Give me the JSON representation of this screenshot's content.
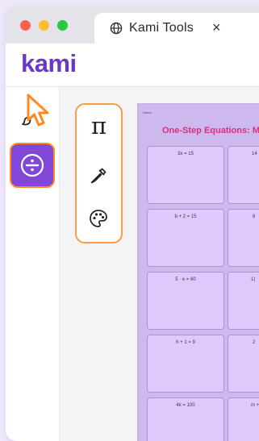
{
  "browser": {
    "tab_title": "Kami Tools",
    "tab_close": "×"
  },
  "app": {
    "logo": "kami",
    "brand_color": "#6b37c6",
    "accent_color": "#ff8a1f"
  },
  "toolbar": {
    "items": [
      {
        "icon": "paintbrush-icon",
        "selected": false
      },
      {
        "icon": "division-icon",
        "selected": true
      }
    ]
  },
  "math_submenu": {
    "items": [
      {
        "icon": "pi-icon",
        "symbol": "π"
      },
      {
        "icon": "eyedropper-icon"
      },
      {
        "icon": "palette-icon"
      }
    ]
  },
  "worksheet": {
    "name_label": "Name:",
    "title": "One-Step Equations: M",
    "problems": [
      "3x = 15",
      "14",
      "b + 2 = 15",
      "8",
      "5 · e = 60",
      "1(",
      "h + 1 = 9",
      "2",
      "4k = 100",
      "m +"
    ]
  }
}
